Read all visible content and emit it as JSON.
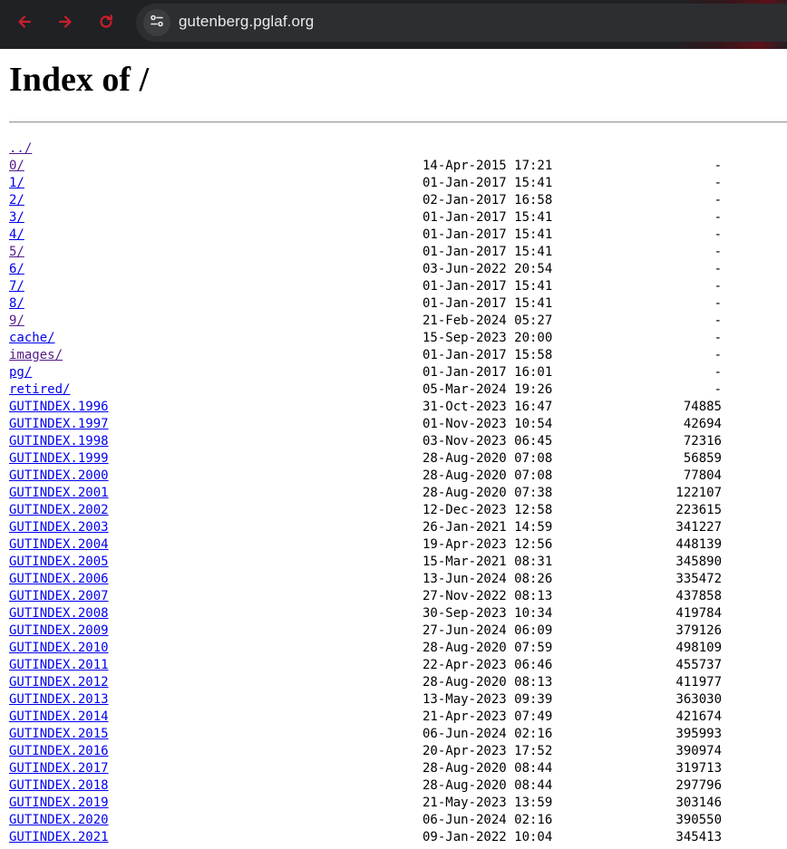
{
  "browser": {
    "url": "gutenberg.pglaf.org",
    "icons": {
      "back": "back-arrow-icon",
      "forward": "forward-arrow-icon",
      "reload": "reload-icon",
      "site_info": "site-info-icon"
    },
    "icon_color": "#cc1e2b"
  },
  "page": {
    "title": "Index of /",
    "entries": [
      {
        "name": "../",
        "date": "",
        "size": "",
        "visited": true
      },
      {
        "name": "0/",
        "date": "14-Apr-2015 17:21",
        "size": "-",
        "visited": true
      },
      {
        "name": "1/",
        "date": "01-Jan-2017 15:41",
        "size": "-",
        "visited": false
      },
      {
        "name": "2/",
        "date": "02-Jan-2017 16:58",
        "size": "-",
        "visited": false
      },
      {
        "name": "3/",
        "date": "01-Jan-2017 15:41",
        "size": "-",
        "visited": false
      },
      {
        "name": "4/",
        "date": "01-Jan-2017 15:41",
        "size": "-",
        "visited": false
      },
      {
        "name": "5/",
        "date": "01-Jan-2017 15:41",
        "size": "-",
        "visited": true
      },
      {
        "name": "6/",
        "date": "03-Jun-2022 20:54",
        "size": "-",
        "visited": false
      },
      {
        "name": "7/",
        "date": "01-Jan-2017 15:41",
        "size": "-",
        "visited": false
      },
      {
        "name": "8/",
        "date": "01-Jan-2017 15:41",
        "size": "-",
        "visited": false
      },
      {
        "name": "9/",
        "date": "21-Feb-2024 05:27",
        "size": "-",
        "visited": true
      },
      {
        "name": "cache/",
        "date": "15-Sep-2023 20:00",
        "size": "-",
        "visited": false
      },
      {
        "name": "images/",
        "date": "01-Jan-2017 15:58",
        "size": "-",
        "visited": true
      },
      {
        "name": "pg/",
        "date": "01-Jan-2017 16:01",
        "size": "-",
        "visited": false
      },
      {
        "name": "retired/",
        "date": "05-Mar-2024 19:26",
        "size": "-",
        "visited": false
      },
      {
        "name": "GUTINDEX.1996",
        "date": "31-Oct-2023 16:47",
        "size": "74885",
        "visited": false
      },
      {
        "name": "GUTINDEX.1997",
        "date": "01-Nov-2023 10:54",
        "size": "42694",
        "visited": false
      },
      {
        "name": "GUTINDEX.1998",
        "date": "03-Nov-2023 06:45",
        "size": "72316",
        "visited": false
      },
      {
        "name": "GUTINDEX.1999",
        "date": "28-Aug-2020 07:08",
        "size": "56859",
        "visited": false
      },
      {
        "name": "GUTINDEX.2000",
        "date": "28-Aug-2020 07:08",
        "size": "77804",
        "visited": false
      },
      {
        "name": "GUTINDEX.2001",
        "date": "28-Aug-2020 07:38",
        "size": "122107",
        "visited": false
      },
      {
        "name": "GUTINDEX.2002",
        "date": "12-Dec-2023 12:58",
        "size": "223615",
        "visited": false
      },
      {
        "name": "GUTINDEX.2003",
        "date": "26-Jan-2021 14:59",
        "size": "341227",
        "visited": false
      },
      {
        "name": "GUTINDEX.2004",
        "date": "19-Apr-2023 12:56",
        "size": "448139",
        "visited": false
      },
      {
        "name": "GUTINDEX.2005",
        "date": "15-Mar-2021 08:31",
        "size": "345890",
        "visited": false
      },
      {
        "name": "GUTINDEX.2006",
        "date": "13-Jun-2024 08:26",
        "size": "335472",
        "visited": false
      },
      {
        "name": "GUTINDEX.2007",
        "date": "27-Nov-2022 08:13",
        "size": "437858",
        "visited": false
      },
      {
        "name": "GUTINDEX.2008",
        "date": "30-Sep-2023 10:34",
        "size": "419784",
        "visited": false
      },
      {
        "name": "GUTINDEX.2009",
        "date": "27-Jun-2024 06:09",
        "size": "379126",
        "visited": false
      },
      {
        "name": "GUTINDEX.2010",
        "date": "28-Aug-2020 07:59",
        "size": "498109",
        "visited": false
      },
      {
        "name": "GUTINDEX.2011",
        "date": "22-Apr-2023 06:46",
        "size": "455737",
        "visited": false
      },
      {
        "name": "GUTINDEX.2012",
        "date": "28-Aug-2020 08:13",
        "size": "411977",
        "visited": false
      },
      {
        "name": "GUTINDEX.2013",
        "date": "13-May-2023 09:39",
        "size": "363030",
        "visited": false
      },
      {
        "name": "GUTINDEX.2014",
        "date": "21-Apr-2023 07:49",
        "size": "421674",
        "visited": false
      },
      {
        "name": "GUTINDEX.2015",
        "date": "06-Jun-2024 02:16",
        "size": "395993",
        "visited": false
      },
      {
        "name": "GUTINDEX.2016",
        "date": "20-Apr-2023 17:52",
        "size": "390974",
        "visited": false
      },
      {
        "name": "GUTINDEX.2017",
        "date": "28-Aug-2020 08:44",
        "size": "319713",
        "visited": false
      },
      {
        "name": "GUTINDEX.2018",
        "date": "28-Aug-2020 08:44",
        "size": "297796",
        "visited": false
      },
      {
        "name": "GUTINDEX.2019",
        "date": "21-May-2023 13:59",
        "size": "303146",
        "visited": false
      },
      {
        "name": "GUTINDEX.2020",
        "date": "06-Jun-2024 02:16",
        "size": "390550",
        "visited": false
      },
      {
        "name": "GUTINDEX.2021",
        "date": "09-Jan-2022 10:04",
        "size": "345413",
        "visited": false
      }
    ]
  }
}
